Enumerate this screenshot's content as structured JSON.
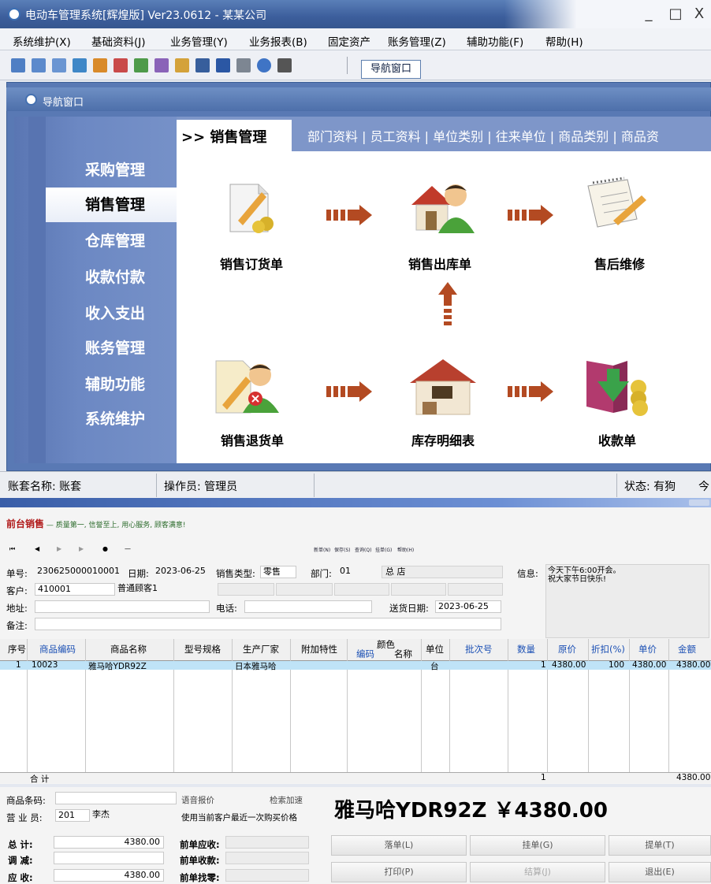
{
  "window": {
    "title": "电动车管理系统[辉煌版] Ver23.0612 - 某某公司",
    "minimize": "_",
    "maximize": "□",
    "close": "X"
  },
  "menu": [
    "系统维护(X)",
    "基础资料(J)",
    "业务管理(Y)",
    "业务报表(B)",
    "固定资产",
    "账务管理(Z)",
    "辅助功能(F)",
    "帮助(H)"
  ],
  "toolbar": {
    "nav_button": "导航窗口"
  },
  "nav_window": {
    "title": "导航窗口",
    "left_items": [
      "采购管理",
      "销售管理",
      "仓库管理",
      "收款付款",
      "收入支出",
      "账务管理",
      "辅助功能",
      "系统维护"
    ],
    "active_item": "销售管理",
    "active_tab": ">> 销售管理",
    "tab_links": "部门资料 | 员工资料 | 单位类别 | 往来单位 | 商品类别 | 商品资",
    "flow": {
      "sales_order": "销售订货单",
      "sales_out": "销售出库单",
      "after_sales": "售后维修",
      "sales_return": "销售退货单",
      "stock_detail": "库存明细表",
      "receipt": "收款单"
    }
  },
  "status_bar": {
    "account": "账套名称: 账套",
    "operator": "操作员: 管理员",
    "state": "状态: 有狗",
    "extra": "今"
  },
  "pos": {
    "logo": "前台销售",
    "slogan": "— 质量第一, 信誉至上, 用心服务, 顾客满意!",
    "toolbar_links": [
      "新单(N)",
      "保存(S)",
      "查询(Q)",
      "挂单(G)",
      "帮助(H)"
    ],
    "form": {
      "order_no_label": "单号:",
      "order_no": "230625000010001",
      "date_label": "日期:",
      "date": "2023-06-25",
      "sale_type_label": "销售类型:",
      "sale_type": "零售",
      "dept_label": "部门:",
      "dept_code": "01",
      "dept_name": "总  店",
      "info_label": "信息:",
      "info_text": "今天下午6:00开会。\n祝大家节日快乐!",
      "customer_label": "客户:",
      "customer_code": "410001",
      "customer_name": "普通顾客1",
      "address_label": "地址:",
      "phone_label": "电话:",
      "delivery_label": "送货日期:",
      "delivery_date": "2023-06-25",
      "note_label": "备注:"
    },
    "grid": {
      "headers": [
        "序号",
        "商品编码",
        "商品名称",
        "型号规格",
        "生产厂家",
        "附加特性",
        "颜色",
        "编码",
        "名称",
        "单位",
        "批次号",
        "数量",
        "原价",
        "折扣(%)",
        "单价",
        "金额"
      ],
      "row": {
        "no": "1",
        "code": "10023",
        "name": "雅马哈YDR92Z",
        "maker": "日本雅马哈",
        "unit": "台",
        "qty": "1",
        "orig_price": "4380.00",
        "discount": "100",
        "price": "4380.00",
        "amount": "4380.00"
      },
      "sum_label": "合  计",
      "sum_qty": "1",
      "sum_amount": "4380.00"
    },
    "bottom": {
      "barcode_label": "商品条码:",
      "salesman_label": "营 业 员:",
      "salesman_code": "201",
      "salesman_name": "李杰",
      "voice": "语音报价",
      "search_speed": "检索加速",
      "last_price": "使用当前客户最近一次购买价格",
      "display": "雅马哈YDR92Z  ￥4380.00",
      "total_label": "总    计:",
      "total": "4380.00",
      "adjust_label": "调    减:",
      "receivable_label": "应    收:",
      "receivable": "4380.00",
      "prev_due": "前单应收:",
      "prev_received": "前单收款:",
      "prev_change": "前单找零:",
      "btn_take": "落单(L)",
      "btn_hang": "挂单(G)",
      "btn_fetch": "提单(T)",
      "btn_print": "打印(P)",
      "btn_settle": "结算(J)",
      "btn_exit": "退出(E)"
    }
  },
  "colors": {
    "accent": "#5979b4",
    "row_highlight": "#bfe3f7",
    "slogan": "#2a6a2a"
  }
}
